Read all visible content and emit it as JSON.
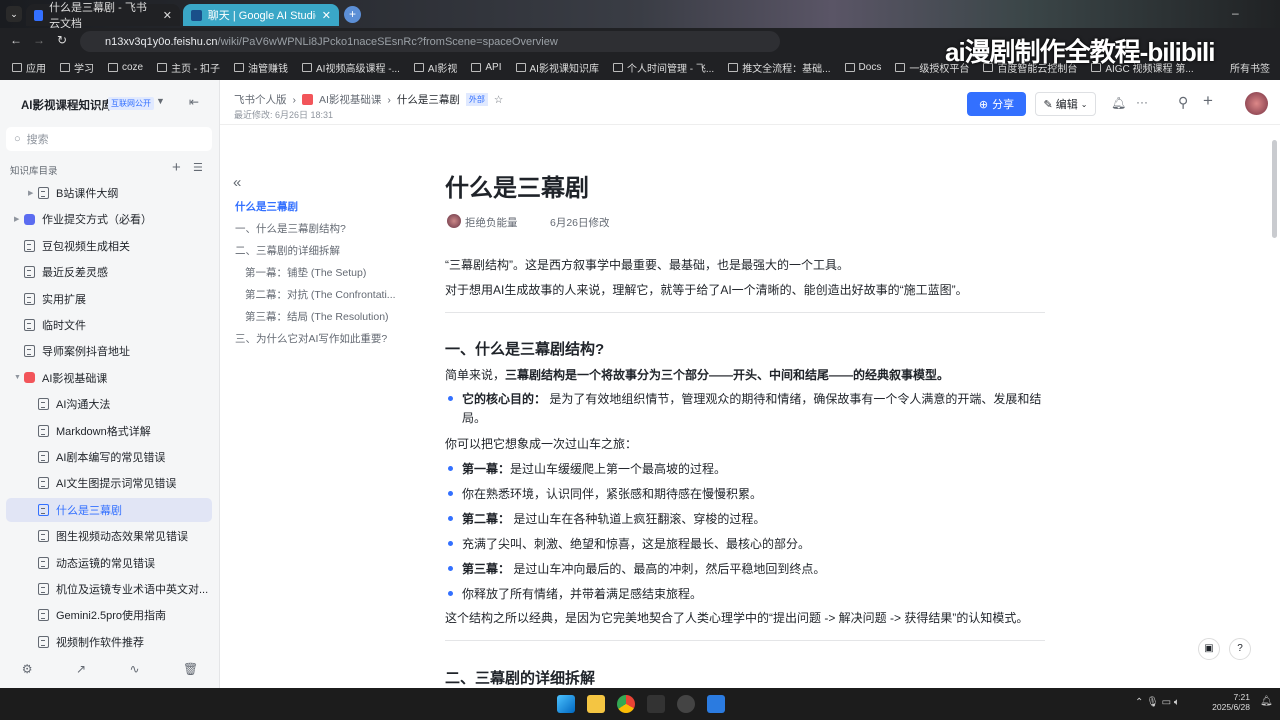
{
  "browser": {
    "tabs": [
      {
        "title": "什么是三幕剧 - 飞书云文档",
        "active": true
      },
      {
        "title": "聊天 | Google AI Studio --- C",
        "active": false
      }
    ],
    "url_host": "n13xv3q1y0o.feishu.cn",
    "url_path": "/wiki/PaV6wWPNLi8JPcko1naceSEsnRc?fromScene=spaceOverview",
    "bookmarks": [
      "应用",
      "学习",
      "coze",
      "主页 - 扣子",
      "油管赚钱",
      "AI视频高级课程 -...",
      "AI影视",
      "API",
      "AI影视课知识库",
      "个人时间管理 - 飞...",
      "推文全流程：基础...",
      "Docs",
      "一级授权平台",
      "百度智能云控制台",
      "AIGC 视频课程 第..."
    ],
    "all_bookmarks": "所有书签",
    "overlay": "ai漫剧制作全教程-bilibili"
  },
  "sidebar": {
    "space_title": "AI影视课程知识库",
    "badge": "互联网公开",
    "search_placeholder": "搜索",
    "section": "知识库目录",
    "items": [
      {
        "label": "B站课件大纲",
        "level": 1,
        "arrow": true
      },
      {
        "label": "作业提交方式（必看）",
        "level": 0,
        "arrow": true,
        "colored": "#5b6cf0"
      },
      {
        "label": "豆包视频生成相关",
        "level": 0
      },
      {
        "label": "最近反差灵感",
        "level": 0
      },
      {
        "label": "实用扩展",
        "level": 0
      },
      {
        "label": "临时文件",
        "level": 0
      },
      {
        "label": "导师案例抖音地址",
        "level": 0
      },
      {
        "label": "AI影视基础课",
        "level": 0,
        "arrow": true,
        "open": true,
        "colored": "#f2555a"
      },
      {
        "label": "AI沟通大法",
        "level": 1
      },
      {
        "label": "Markdown格式详解",
        "level": 1
      },
      {
        "label": "AI剧本编写的常见错误",
        "level": 1
      },
      {
        "label": "AI文生图提示词常见错误",
        "level": 1
      },
      {
        "label": "什么是三幕剧",
        "level": 1,
        "active": true
      },
      {
        "label": "图生视频动态效果常见错误",
        "level": 1
      },
      {
        "label": "动态运镜的常见错误",
        "level": 1
      },
      {
        "label": "机位及运镜专业术语中英文对...",
        "level": 1
      },
      {
        "label": "Gemini2.5pro使用指南",
        "level": 1
      },
      {
        "label": "视频制作软件推荐",
        "level": 1
      }
    ]
  },
  "header": {
    "breadcrumb": [
      "飞书个人版",
      "AI影视基础课",
      "什么是三幕剧"
    ],
    "external_tag": "外部",
    "last_modified": "最近修改: 6月26日 18:31",
    "share": "分享",
    "edit": "编辑"
  },
  "toc": {
    "items": [
      {
        "label": "什么是三幕剧",
        "active": true,
        "indent": 0
      },
      {
        "label": "一、什么是三幕剧结构?",
        "indent": 0
      },
      {
        "label": "二、三幕剧的详细拆解",
        "indent": 0
      },
      {
        "label": "第一幕：铺垫 (The Setup)",
        "indent": 1
      },
      {
        "label": "第二幕：对抗 (The Confrontati...",
        "indent": 1
      },
      {
        "label": "第三幕：结局 (The Resolution)",
        "indent": 1
      },
      {
        "label": "三、为什么它对AI写作如此重要?",
        "indent": 0
      }
    ]
  },
  "doc": {
    "title": "什么是三幕剧",
    "author": "拒绝负能量",
    "modified": "6月26日修改",
    "intro": [
      "“三幕剧结构”。这是西方叙事学中最重要、最基础，也是最强大的一个工具。",
      "对于想用AI生成故事的人来说，理解它，就等于给了AI一个清晰的、能创造出好故事的“施工蓝图”。"
    ],
    "h1": "一、什么是三幕剧结构?",
    "p1_prefix": "简单来说，",
    "p1_bold": "三幕剧结构是一个将故事分为三个部分——开头、中间和结尾——的经典叙事模型。",
    "core_bold": "它的核心目的：",
    "core_text": " 是为了有效地组织情节，管理观众的期待和情绪，确保故事有一个令人满意的开端、发展和结局。",
    "p2": "你可以把它想象成一次过山车之旅：",
    "bullets": [
      {
        "bold": "第一幕：",
        "text": "是过山车缓缓爬上第一个最高坡的过程。"
      },
      {
        "bold": "",
        "text": "你在熟悉环境，认识同伴，紧张感和期待感在慢慢积累。"
      },
      {
        "bold": "第二幕：",
        "text": " 是过山车在各种轨道上疯狂翻滚、穿梭的过程。"
      },
      {
        "bold": "",
        "text": "充满了尖叫、刺激、绝望和惊喜，这是旅程最长、最核心的部分。"
      },
      {
        "bold": "第三幕：",
        "text": " 是过山车冲向最后的、最高的冲刺，然后平稳地回到终点。"
      },
      {
        "bold": "",
        "text": "你释放了所有情绪，并带着满足感结束旅程。"
      }
    ],
    "p3": "这个结构之所以经典，是因为它完美地契合了人类心理学中的“提出问题 -> 解决问题 -> 获得结果”的认知模式。",
    "h2": "二、三幕剧的详细拆解"
  },
  "taskbar": {
    "time": "7:21",
    "date": "2025/6/28"
  },
  "colors": {
    "accent": "#3370ff",
    "active_bg": "#e1e5f5"
  }
}
